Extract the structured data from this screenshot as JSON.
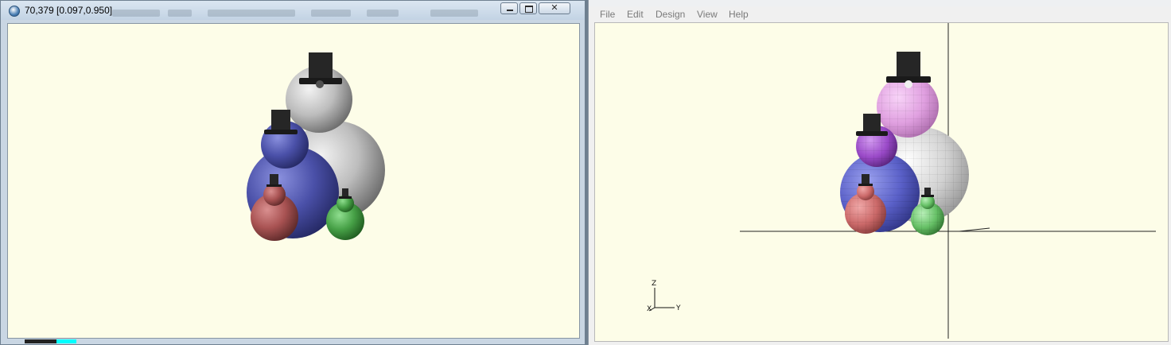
{
  "left_window": {
    "title": "70,379 [0.097,0.950]",
    "buttons": {
      "minimize": "minimize",
      "maximize": "maximize",
      "close": "close"
    },
    "close_glyph": "✕",
    "background": "#fdfde8"
  },
  "right_window": {
    "menu": [
      {
        "id": "file",
        "label": "File"
      },
      {
        "id": "edit",
        "label": "Edit"
      },
      {
        "id": "design",
        "label": "Design"
      },
      {
        "id": "view",
        "label": "View"
      },
      {
        "id": "help",
        "label": "Help"
      }
    ],
    "axes_labels": {
      "z": "Z",
      "x": "X",
      "y": "Y"
    },
    "background": "#fdfde8"
  },
  "scene": {
    "objects": [
      "white snowman",
      "blue snowman",
      "red snowman",
      "green snowman"
    ],
    "colors": {
      "white": "#c8c8c8",
      "blue": "#4a50a8",
      "red": "#b85a5a",
      "green": "#4aa84a",
      "pink": "#e8a8e8",
      "purple": "#9a4ac8",
      "hat": "#222222"
    }
  }
}
